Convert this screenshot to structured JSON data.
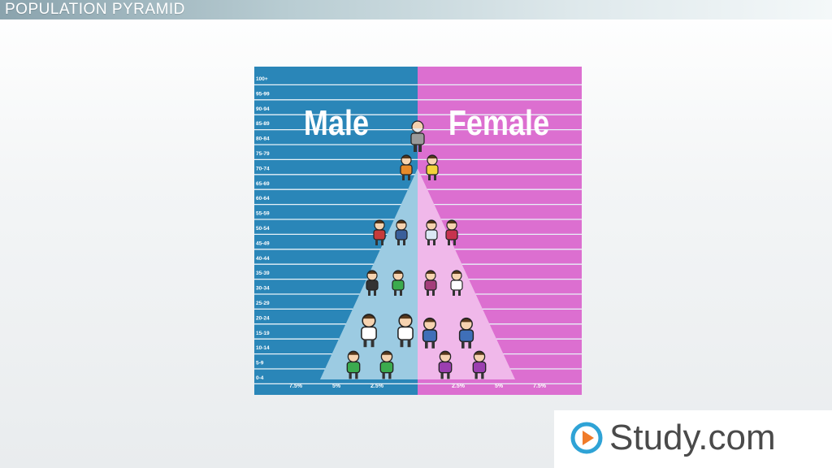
{
  "header": {
    "title": "POPULATION PYRAMID"
  },
  "chart_data": {
    "type": "population-pyramid",
    "left_label": "Male",
    "right_label": "Female",
    "age_groups": [
      "100+",
      "95-99",
      "90-94",
      "85-89",
      "80-84",
      "75-79",
      "70-74",
      "65-69",
      "60-64",
      "55-59",
      "50-54",
      "45-49",
      "40-44",
      "35-39",
      "30-34",
      "25-29",
      "20-24",
      "15-19",
      "10-14",
      "5-9",
      "0-4"
    ],
    "x_ticks_left": [
      "7.5%",
      "5%",
      "2.5%"
    ],
    "x_ticks_right": [
      "2.5%",
      "5%",
      "7.5%"
    ],
    "x_tick_values_left": [
      7.5,
      5,
      2.5
    ],
    "x_tick_values_right": [
      2.5,
      5,
      7.5
    ],
    "pyramid_half_width_at_base_pct": 5,
    "pyramid_top_age_group": "70-74",
    "colors": {
      "male_bg": "#2a86b8",
      "female_bg": "#dc6fd0",
      "male_pyramid": "#9ccbe2",
      "female_pyramid": "#f0b8ea",
      "gridline": "#e8f2f8"
    }
  },
  "brand": {
    "name": "Study.com",
    "accent": "#2fa3d6"
  }
}
